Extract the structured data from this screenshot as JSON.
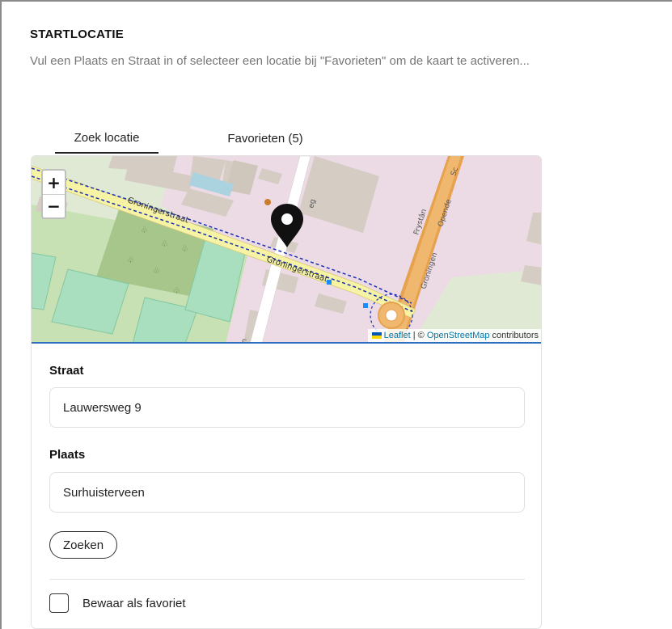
{
  "section": {
    "title": "STARTLOCATIE",
    "intro": "Vul een Plaats en Straat in of selecteer een locatie bij \"Favorieten\" om de kaart te activeren..."
  },
  "tabs": [
    {
      "label": "Zoek locatie",
      "active": true
    },
    {
      "label": "Favorieten (5)",
      "active": false
    }
  ],
  "map": {
    "zoom_in": "+",
    "zoom_out": "−",
    "streets": {
      "groningerstraat_1": "Groningerstraat",
      "groningerstraat_2": "Groningerstraat",
      "frystan": "Frystân",
      "opende": "Opende",
      "groningen": "Groningen",
      "weg_fragment": "eg",
      "sc_fragment": "Sc",
      "bottom_fragment": "n"
    },
    "attribution": {
      "leaflet": "Leaflet",
      "separator": " | © ",
      "osm": "OpenStreetMap",
      "contributors": " contributors"
    },
    "colors": {
      "land": "#dfe9d3",
      "residential": "#ecdbe4",
      "building": "#d5ccc4",
      "sports": "#a9dfbf",
      "park": "#b5d29f",
      "main_road": "#f0b76e",
      "road": "#f6f4a4",
      "route": "#1a2fb3",
      "accent": "#2f6ebf"
    }
  },
  "form": {
    "street_label": "Straat",
    "street_value": "Lauwersweg 9",
    "city_label": "Plaats",
    "city_value": "Surhuisterveen",
    "search_button": "Zoeken",
    "favorite_label": "Bewaar als favoriet",
    "favorite_checked": false
  }
}
